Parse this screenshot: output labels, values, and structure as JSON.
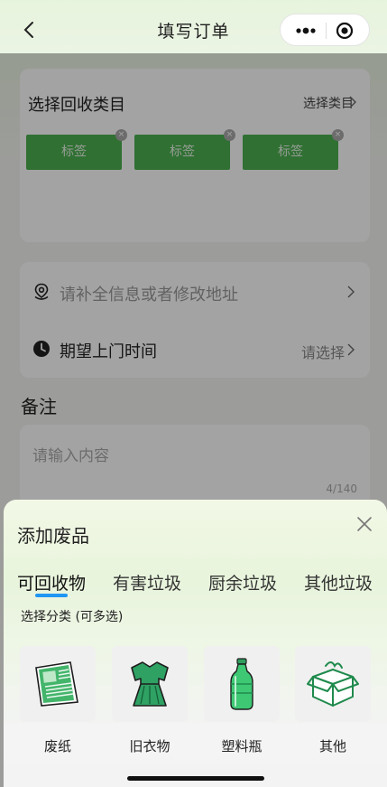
{
  "navbar": {
    "title": "填写订单"
  },
  "category": {
    "title": "选择回收类目",
    "select_label": "选择类目",
    "tags": [
      {
        "label": "标签"
      },
      {
        "label": "标签"
      },
      {
        "label": "标签"
      }
    ]
  },
  "address": {
    "placeholder": "请补全信息或者修改地址"
  },
  "visit_time": {
    "label": "期望上门时间",
    "value": "请选择"
  },
  "remark": {
    "title": "备注",
    "placeholder": "请输入内容",
    "counter": "4/140"
  },
  "sheet": {
    "title": "添加废品",
    "tabs": [
      {
        "label": "可回收物"
      },
      {
        "label": "有害垃圾"
      },
      {
        "label": "厨余垃圾"
      },
      {
        "label": "其他垃圾"
      }
    ],
    "active_tab": 0,
    "hint": "选择分类 (可多选)",
    "items": [
      {
        "label": "废纸",
        "icon": "newspaper-icon"
      },
      {
        "label": "旧衣物",
        "icon": "dress-icon"
      },
      {
        "label": "塑料瓶",
        "icon": "plastic-bottle-icon"
      },
      {
        "label": "其他",
        "icon": "box-icon"
      }
    ]
  },
  "colors": {
    "accent_green": "#4caf50",
    "tab_underline": "#2196f3",
    "icon_green": "#2e9e5e"
  }
}
